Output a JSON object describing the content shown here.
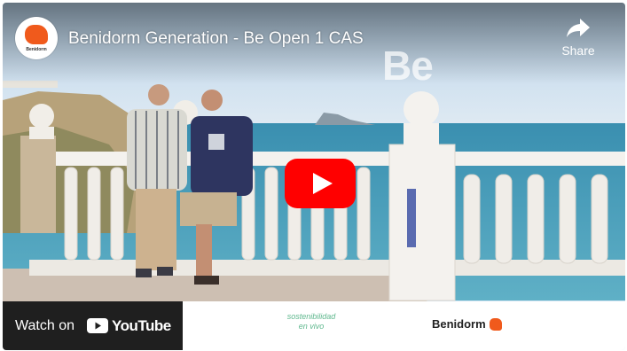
{
  "video": {
    "title": "Benidorm Generation - Be Open 1 CAS",
    "watermark": "Be",
    "channel_avatar_text": "Benidorm",
    "channel_avatar_blob_text": "VISIT BENIDORM"
  },
  "controls": {
    "share_label": "Share",
    "play_icon": "youtube-play-icon",
    "share_icon": "share-arrow-icon"
  },
  "bottom_bar": {
    "watch_on_label": "Watch on",
    "youtube_wordmark": "YouTube",
    "sponsor_1_line_1": "sostenibilidad",
    "sponsor_1_line_2": "en vivo",
    "sponsor_2_name": "Benidorm"
  },
  "colors": {
    "youtube_red": "#ff0000",
    "brand_orange": "#f05a1c",
    "watch_on_bg": "#1f1f1f"
  }
}
